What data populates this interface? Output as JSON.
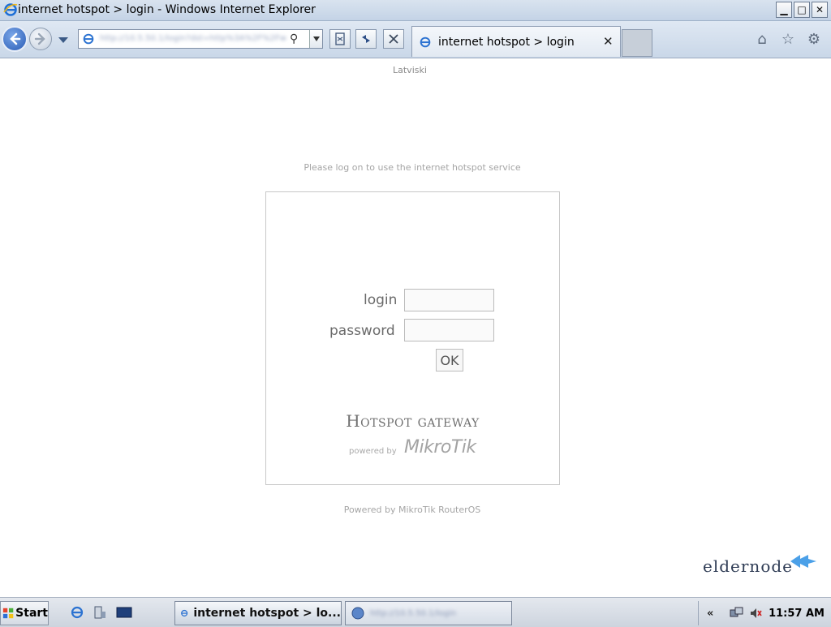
{
  "window": {
    "title": "internet hotspot > login - Windows Internet Explorer",
    "minimize": "▁",
    "maximize": "□",
    "close": "✕"
  },
  "navbar": {
    "address_url": "http://10.5.50.1/login?dst=http%3A%2F%2Fwww",
    "address_icon": "ie-icon",
    "tab_label": "internet hotspot > login",
    "tab_close": "✕"
  },
  "page": {
    "language_link": "Latviski",
    "notice": "Please log on to use the internet hotspot service",
    "login_label": "login",
    "password_label": "password",
    "ok_button": "OK",
    "brand_title": "Hotspot gateway",
    "powered_by_small": "powered by",
    "mikrotik_logo": "MikroTik",
    "footer": "Powered by MikroTik RouterOS",
    "watermark": "eldernode"
  },
  "taskbar": {
    "start_label": "Start",
    "task1_label": "internet hotspot > lo...",
    "task2_label": "http://10.5.50.1/login",
    "tray_chevron": "«",
    "clock": "11:57 AM"
  }
}
